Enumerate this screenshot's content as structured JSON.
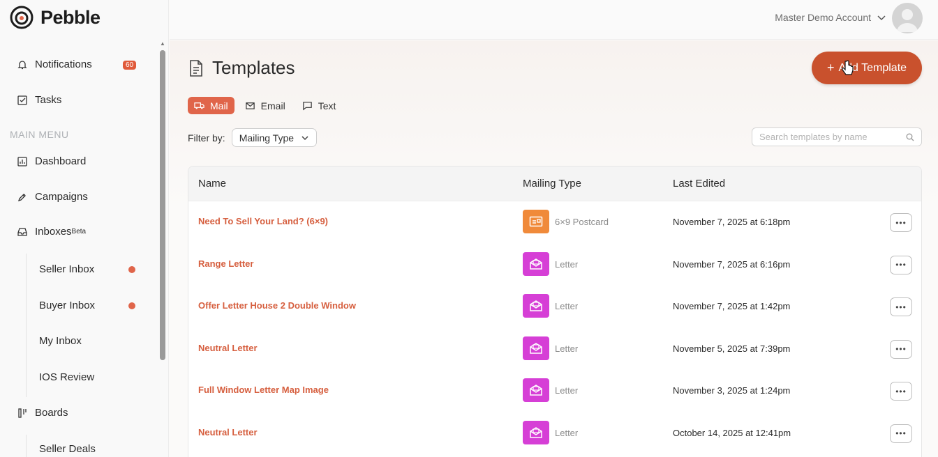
{
  "brand": {
    "name": "Pebble",
    "accent": "#e0654a"
  },
  "sidebar": {
    "notifications": {
      "label": "Notifications",
      "count": "60"
    },
    "tasks": {
      "label": "Tasks"
    },
    "section_label": "MAIN MENU",
    "dashboard": {
      "label": "Dashboard"
    },
    "campaigns": {
      "label": "Campaigns"
    },
    "inboxes": {
      "label": "Inboxes",
      "sup": "Beta"
    },
    "inbox_items": [
      {
        "label": "Seller Inbox"
      },
      {
        "label": "Buyer Inbox"
      },
      {
        "label": "My Inbox"
      },
      {
        "label": "IOS Review"
      }
    ],
    "boards": {
      "label": "Boards"
    },
    "board_items": [
      {
        "label": "Seller Deals"
      }
    ]
  },
  "header": {
    "account": "Master Demo Account"
  },
  "page": {
    "title": "Templates",
    "add_button": "Add Template",
    "tabs": [
      {
        "label": "Mail",
        "active": true
      },
      {
        "label": "Email",
        "active": false
      },
      {
        "label": "Text",
        "active": false
      }
    ],
    "filter_label": "Filter by:",
    "filter_value": "Mailing Type",
    "search_placeholder": "Search templates by name"
  },
  "table": {
    "columns": [
      "Name",
      "Mailing Type",
      "Last Edited"
    ],
    "rows": [
      {
        "name": "Need To Sell Your Land? (6×9)",
        "type": "6×9 Postcard",
        "type_icon": "postcard-icon",
        "color": "#f08a3a",
        "edited": "November 7, 2025 at 6:18pm"
      },
      {
        "name": "Range Letter",
        "type": "Letter",
        "type_icon": "letter-icon",
        "color": "#d63fd6",
        "edited": "November 7, 2025 at 6:16pm"
      },
      {
        "name": "Offer Letter House 2 Double Window",
        "type": "Letter",
        "type_icon": "letter-icon",
        "color": "#d63fd6",
        "edited": "November 7, 2025 at 1:42pm"
      },
      {
        "name": "Neutral Letter",
        "type": "Letter",
        "type_icon": "letter-icon",
        "color": "#d63fd6",
        "edited": "November 5, 2025 at 7:39pm"
      },
      {
        "name": "Full Window Letter Map Image",
        "type": "Letter",
        "type_icon": "letter-icon",
        "color": "#d63fd6",
        "edited": "November 3, 2025 at 1:24pm"
      },
      {
        "name": "Neutral Letter",
        "type": "Letter",
        "type_icon": "letter-icon",
        "color": "#d63fd6",
        "edited": "October 14, 2025 at 12:41pm"
      }
    ]
  }
}
